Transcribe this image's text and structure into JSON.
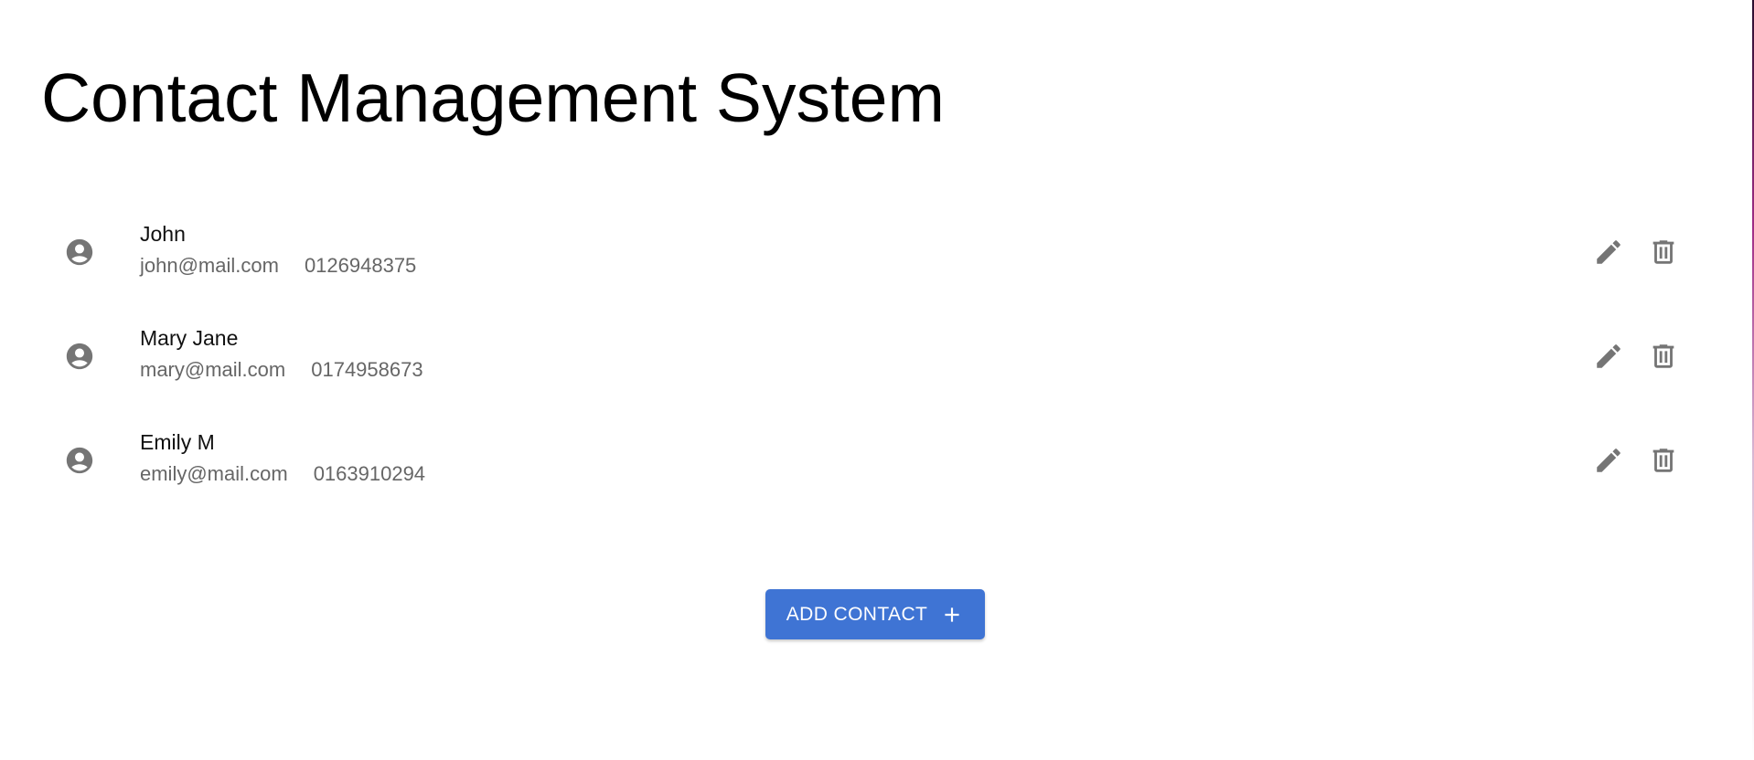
{
  "page": {
    "title": "Contact Management System"
  },
  "contacts": [
    {
      "name": "John",
      "email": "john@mail.com",
      "phone": "0126948375"
    },
    {
      "name": "Mary Jane",
      "email": "mary@mail.com",
      "phone": "0174958673"
    },
    {
      "name": "Emily M",
      "email": "emily@mail.com",
      "phone": "0163910294"
    }
  ],
  "icons": {
    "avatar": "account-circle-icon",
    "edit": "pencil-icon",
    "delete": "trash-icon",
    "add": "plus-icon"
  },
  "add_button": {
    "label": "ADD CONTACT"
  },
  "colors": {
    "primary": "#3f74d4",
    "icon_grey": "#757575",
    "secondary_text": "#666666"
  }
}
